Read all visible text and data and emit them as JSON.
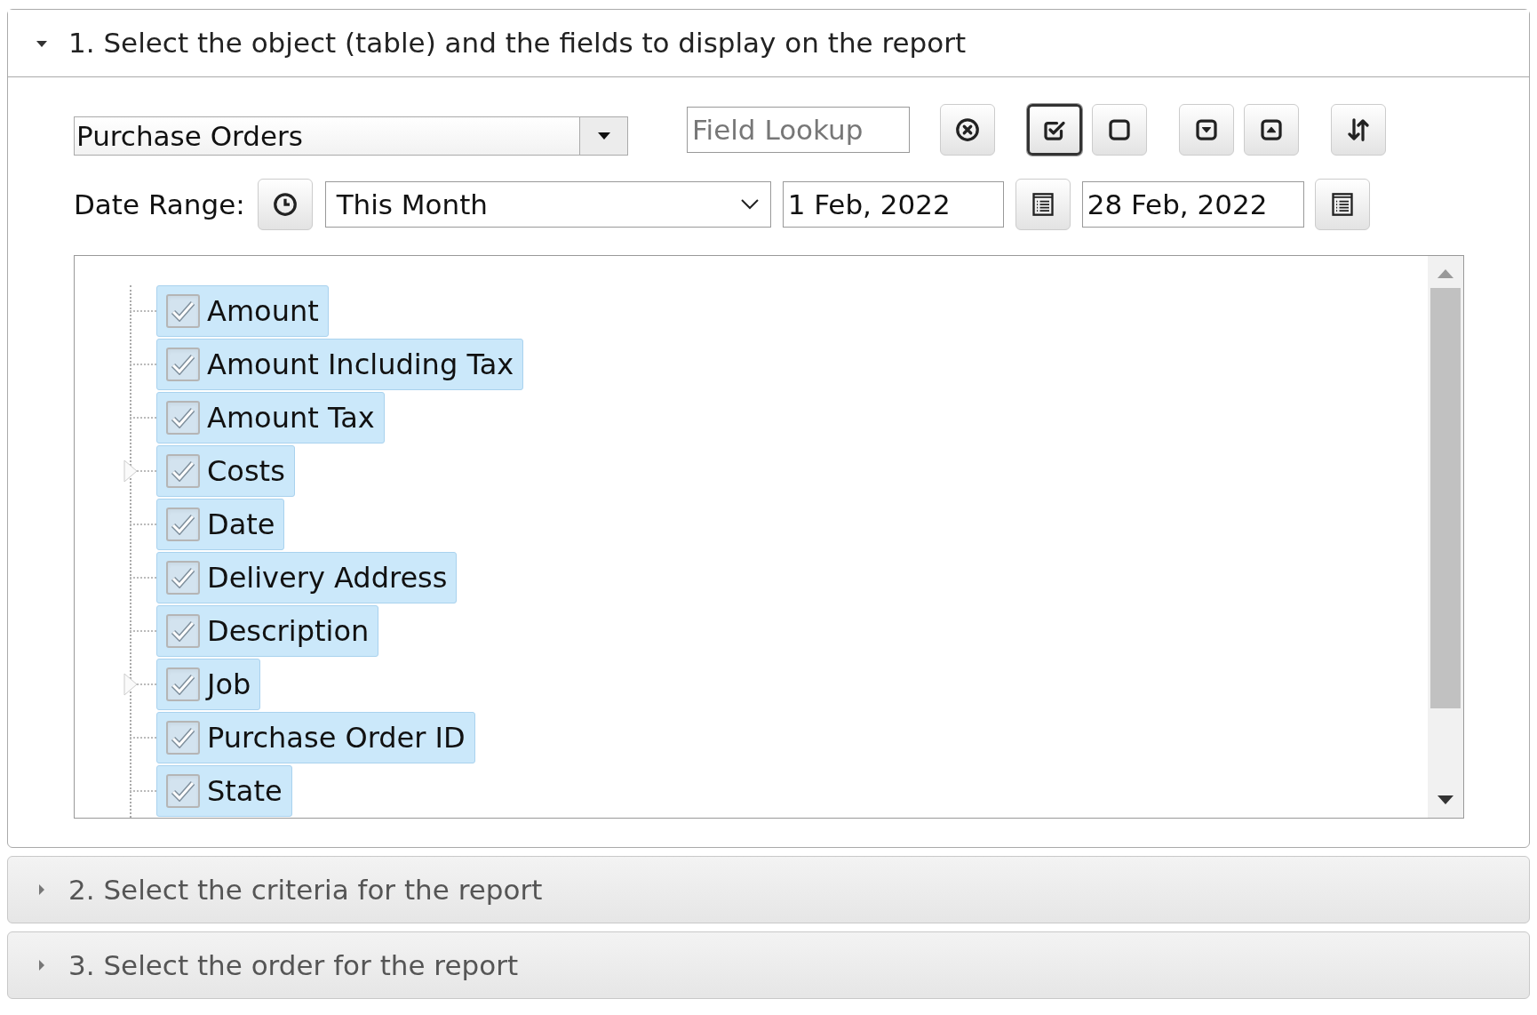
{
  "panels": [
    {
      "title": "1. Select the object (table) and the fields to display on the report",
      "expanded": true
    },
    {
      "title": "2. Select the criteria for the report",
      "expanded": false
    },
    {
      "title": "3. Select the order for the report",
      "expanded": false
    }
  ],
  "object_select": {
    "value": "Purchase Orders"
  },
  "field_lookup": {
    "placeholder": "Field Lookup"
  },
  "toolbar_buttons": [
    {
      "kind": "clear",
      "selected": false
    },
    {
      "kind": "check-all",
      "selected": true
    },
    {
      "kind": "uncheck-all",
      "selected": false
    },
    {
      "kind": "expand-all",
      "selected": false
    },
    {
      "kind": "collapse-all",
      "selected": false
    },
    {
      "kind": "sort",
      "selected": false
    }
  ],
  "date_range": {
    "label": "Date Range:",
    "period": "This Month",
    "from": "1 Feb, 2022",
    "to": "28 Feb, 2022"
  },
  "fields": [
    {
      "label": "Amount",
      "checked": true,
      "selected": true,
      "expandable": false
    },
    {
      "label": "Amount Including Tax",
      "checked": true,
      "selected": true,
      "expandable": false
    },
    {
      "label": "Amount Tax",
      "checked": true,
      "selected": true,
      "expandable": false
    },
    {
      "label": "Costs",
      "checked": true,
      "selected": true,
      "expandable": true
    },
    {
      "label": "Date",
      "checked": true,
      "selected": true,
      "expandable": false
    },
    {
      "label": "Delivery Address",
      "checked": true,
      "selected": true,
      "expandable": false
    },
    {
      "label": "Description",
      "checked": true,
      "selected": true,
      "expandable": false
    },
    {
      "label": "Job",
      "checked": true,
      "selected": true,
      "expandable": true
    },
    {
      "label": "Purchase Order ID",
      "checked": true,
      "selected": true,
      "expandable": false
    },
    {
      "label": "State",
      "checked": true,
      "selected": true,
      "expandable": false
    }
  ]
}
